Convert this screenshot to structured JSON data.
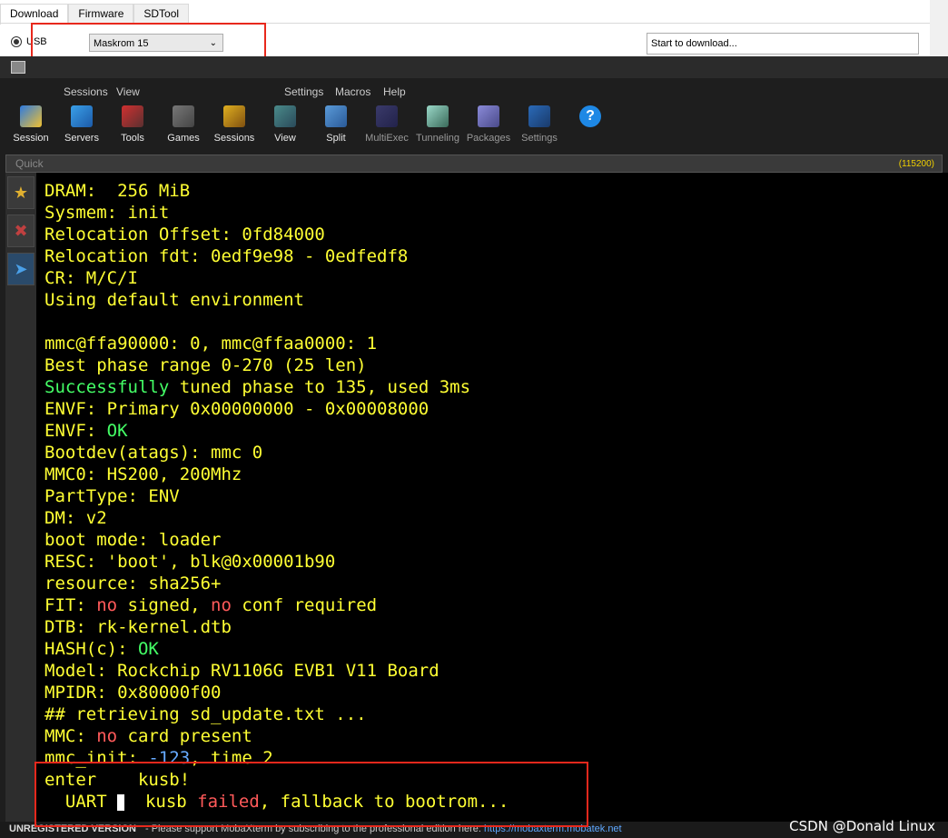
{
  "top_tool": {
    "tabs": [
      "Download",
      "Firmware",
      "SDTool"
    ],
    "usb_label": "USB",
    "device_select": "Maskrom  15",
    "log_text": "Start to download..."
  },
  "moba": {
    "menu": [
      "Sessions",
      "View",
      "Settings",
      "Macros",
      "Help"
    ],
    "toolbar": [
      "Session",
      "Servers",
      "Tools",
      "Games",
      "Sessions",
      "View",
      "Split",
      "MultiExec",
      "Tunneling",
      "Packages",
      "Settings",
      "Help"
    ],
    "quick_connect_placeholder": "Quick",
    "baud": "(115200)",
    "status_unregistered": "UNREGISTERED VERSION",
    "status_message": " -  Please support MobaXterm by subscribing to the professional edition here: ",
    "status_url": "https://mobaxterm.mobatek.net"
  },
  "terminal_lines": [
    [
      {
        "t": "DRAM:  256 MiB",
        "c": ""
      }
    ],
    [
      {
        "t": "Sysmem: init",
        "c": ""
      }
    ],
    [
      {
        "t": "Relocation Offset: 0fd84000",
        "c": ""
      }
    ],
    [
      {
        "t": "Relocation fdt: 0edf9e98 - 0edfedf8",
        "c": ""
      }
    ],
    [
      {
        "t": "CR: M/C/I",
        "c": ""
      }
    ],
    [
      {
        "t": "Using default environment",
        "c": ""
      }
    ],
    [
      {
        "t": "",
        "c": ""
      }
    ],
    [
      {
        "t": "mmc@ffa90000: 0, mmc@ffaa0000: 1",
        "c": ""
      }
    ],
    [
      {
        "t": "Best phase range 0-270 (25 len)",
        "c": ""
      }
    ],
    [
      {
        "t": "Successfully",
        "c": "g"
      },
      {
        "t": " tuned phase to 135, used 3ms",
        "c": ""
      }
    ],
    [
      {
        "t": "ENVF: Primary 0x00000000 - 0x00008000",
        "c": ""
      }
    ],
    [
      {
        "t": "ENVF: ",
        "c": ""
      },
      {
        "t": "OK",
        "c": "g"
      }
    ],
    [
      {
        "t": "Bootdev(atags): mmc 0",
        "c": ""
      }
    ],
    [
      {
        "t": "MMC0: HS200, 200Mhz",
        "c": ""
      }
    ],
    [
      {
        "t": "PartType: ENV",
        "c": ""
      }
    ],
    [
      {
        "t": "DM: v2",
        "c": ""
      }
    ],
    [
      {
        "t": "boot mode: loader",
        "c": ""
      }
    ],
    [
      {
        "t": "RESC: 'boot', blk@0x00001b90",
        "c": ""
      }
    ],
    [
      {
        "t": "resource: sha256+",
        "c": ""
      }
    ],
    [
      {
        "t": "FIT: ",
        "c": ""
      },
      {
        "t": "no",
        "c": "r"
      },
      {
        "t": " signed, ",
        "c": ""
      },
      {
        "t": "no",
        "c": "r"
      },
      {
        "t": " conf required",
        "c": ""
      }
    ],
    [
      {
        "t": "DTB: rk-kernel.dtb",
        "c": ""
      }
    ],
    [
      {
        "t": "HASH(c): ",
        "c": ""
      },
      {
        "t": "OK",
        "c": "g"
      }
    ],
    [
      {
        "t": "Model: Rockchip RV1106G EVB1 V11 Board",
        "c": ""
      }
    ],
    [
      {
        "t": "MPIDR: 0x80000f00",
        "c": ""
      }
    ],
    [
      {
        "t": "## retrieving sd_update.txt ...",
        "c": ""
      }
    ],
    [
      {
        "t": "MMC: ",
        "c": ""
      },
      {
        "t": "no",
        "c": "r"
      },
      {
        "t": " card present",
        "c": ""
      }
    ],
    [
      {
        "t": "mmc_init: ",
        "c": ""
      },
      {
        "t": "-123",
        "c": "b"
      },
      {
        "t": ", time 2",
        "c": ""
      }
    ],
    [
      {
        "t": "enter    kusb!",
        "c": ""
      }
    ],
    [
      {
        "t": "  UART ",
        "c": ""
      },
      {
        "t": "CURSOR",
        "c": "cursor"
      },
      {
        "t": "  kusb ",
        "c": ""
      },
      {
        "t": "failed",
        "c": "r"
      },
      {
        "t": ", fallback to bootrom...",
        "c": ""
      }
    ]
  ],
  "watermark": "CSDN @Donald Linux"
}
